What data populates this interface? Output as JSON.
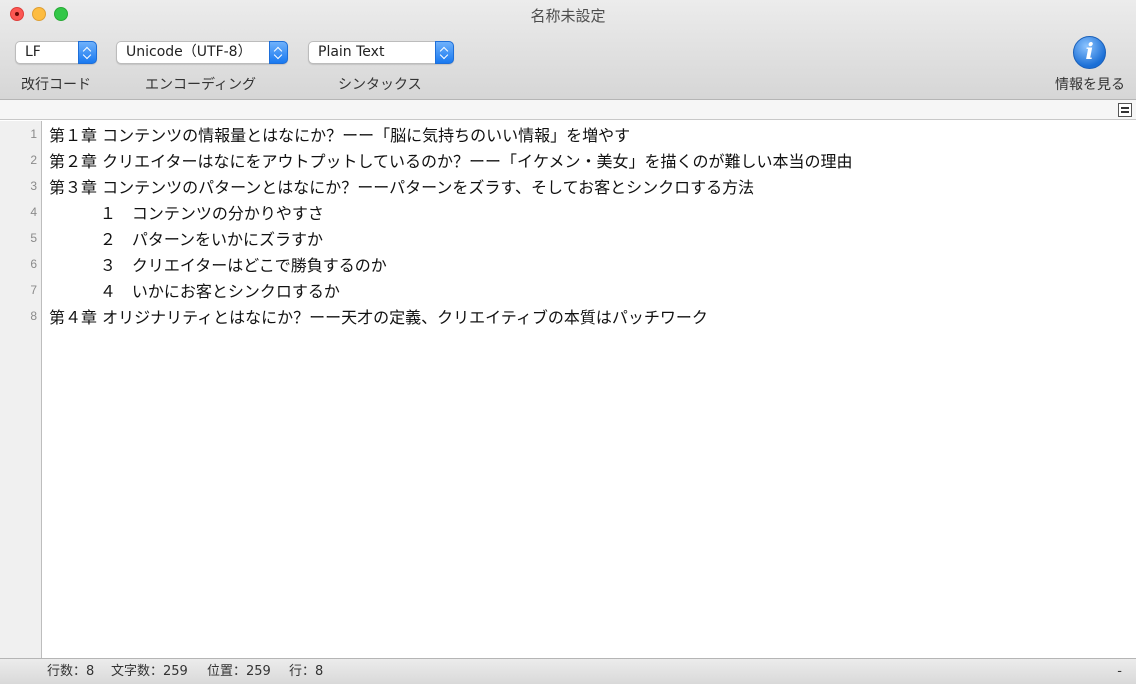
{
  "window": {
    "title": "名称未設定"
  },
  "toolbar": {
    "line_ending": {
      "value": "LF",
      "label": "改行コード"
    },
    "encoding": {
      "value": "Unicode（UTF-8）",
      "label": "エンコーディング"
    },
    "syntax": {
      "value": "Plain Text",
      "label": "シンタックス"
    },
    "info": {
      "label": "情報を見る",
      "icon": "info-icon"
    }
  },
  "editor": {
    "line_numbers": [
      "1",
      "2",
      "3",
      "4",
      "5",
      "6",
      "7",
      "8"
    ],
    "lines": [
      "第１章 コンテンツの情報量とはなにか？ーー「脳に気持ちのいい情報」を増やす",
      "第２章 クリエイターはなにをアウトプットしているのか？ーー「イケメン・美女」を描くのが難しい本当の理由",
      "第３章 コンテンツのパターンとはなにか？ーーパターンをズラす、そしてお客とシンクロする方法",
      "          １　コンテンツの分かりやすさ",
      "          ２　パターンをいかにズラすか",
      "          ３　クリエイターはどこで勝負するのか",
      "          ４　いかにお客とシンクロするか",
      "第４章 オリジナリティとはなにか？ーー天才の定義、クリエイティブの本質はパッチワーク"
    ]
  },
  "status": {
    "lines": "行数：8",
    "chars": "文字数：259",
    "position": "位置：259",
    "row": "行：8",
    "right": "-"
  },
  "colors": {
    "close": "#fc5753",
    "minimize": "#fdbc40",
    "maximize": "#33c748",
    "accent": "#1979f0"
  }
}
